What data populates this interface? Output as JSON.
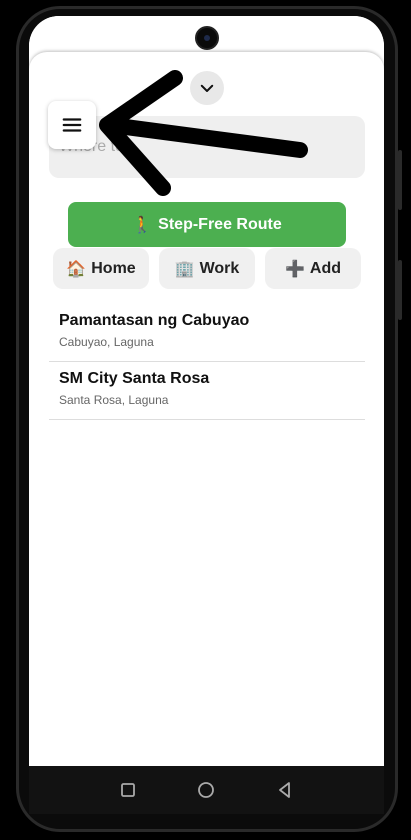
{
  "search": {
    "placeholder": "Where to?"
  },
  "actions": {
    "step_free_label": "Step-Free Route"
  },
  "quick_buttons": [
    {
      "label": "Home",
      "icon": "house-emoji"
    },
    {
      "label": "Work",
      "icon": "office-building-emoji"
    },
    {
      "label": "Add",
      "icon": "plus-emoji"
    }
  ],
  "places": [
    {
      "name": "Pamantasan ng Cabuyao",
      "address": "Cabuyao, Laguna"
    },
    {
      "name": "SM City Santa Rosa",
      "address": "Santa Rosa, Laguna"
    }
  ],
  "colors": {
    "accent_green": "#4caf50",
    "annotation_arrow": "#000000"
  }
}
